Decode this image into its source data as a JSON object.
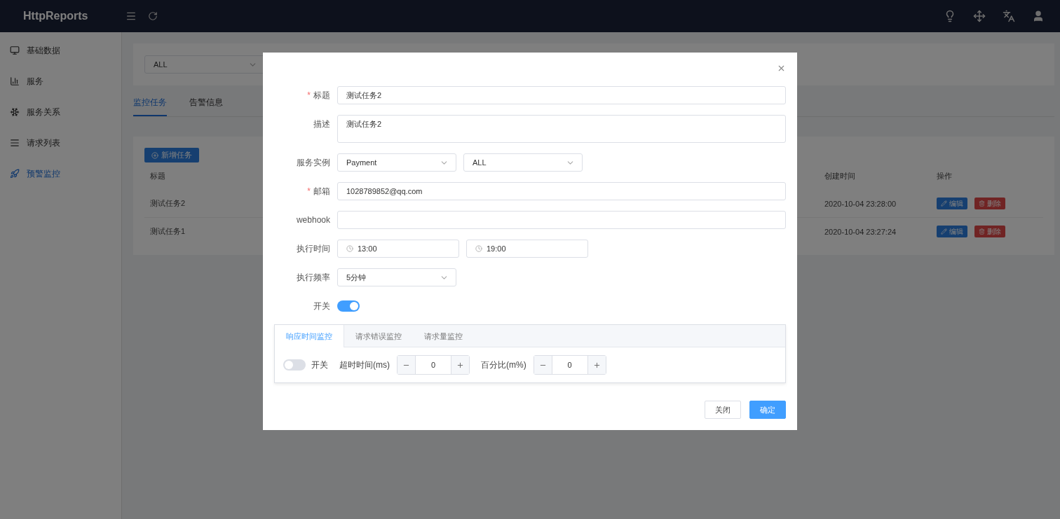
{
  "header": {
    "brand": "HttpReports"
  },
  "sidebar": {
    "items": [
      {
        "label": "基础数据",
        "kind": "monitor",
        "selected": false
      },
      {
        "label": "服务",
        "kind": "chart",
        "selected": false
      },
      {
        "label": "服务关系",
        "kind": "snowflake",
        "selected": false
      },
      {
        "label": "请求列表",
        "kind": "list",
        "selected": false
      },
      {
        "label": "预警监控",
        "kind": "rocket",
        "selected": true
      }
    ]
  },
  "filter": {
    "value": "ALL"
  },
  "tabs": [
    {
      "label": "监控任务",
      "selected": true
    },
    {
      "label": "告警信息",
      "selected": false
    }
  ],
  "task_list": {
    "add_button": "新增任务",
    "columns": [
      "标题",
      "创建时间",
      "操作"
    ],
    "rows": [
      {
        "title": "测试任务2",
        "created": "2020-10-04 23:28:00",
        "edit": "编辑",
        "delete": "删除"
      },
      {
        "title": "测试任务1",
        "created": "2020-10-04 23:27:24",
        "edit": "编辑",
        "delete": "删除"
      }
    ]
  },
  "dialog": {
    "fields": [
      {
        "kind": "text",
        "required_mark": "*",
        "label": "标题",
        "value": "测试任务2"
      },
      {
        "kind": "textarea",
        "label": "描述",
        "value": "测试任务2"
      },
      {
        "kind": "selects",
        "label": "服务实例",
        "values": [
          "Payment",
          "ALL"
        ]
      },
      {
        "kind": "text",
        "required_mark": "*",
        "label": "邮箱",
        "value": "1028789852@qq.com"
      },
      {
        "kind": "text",
        "label": "webhook"
      },
      {
        "kind": "times",
        "label": "执行时间",
        "values": [
          "13:00",
          "19:00"
        ]
      },
      {
        "kind": "selects",
        "label": "执行频率",
        "values": [
          "5分钟"
        ]
      },
      {
        "kind": "switch",
        "label": "开关",
        "on": true
      }
    ],
    "monitor_tabs": [
      {
        "label": "响应时间监控",
        "selected": true
      },
      {
        "label": "请求错误监控",
        "selected": false
      },
      {
        "label": "请求量监控",
        "selected": false
      }
    ],
    "monitor": {
      "switch_label": "开关",
      "on": false,
      "timeout_label": "超时时间(ms)",
      "timeout": "0",
      "percent_label": "百分比(m%)",
      "percent": "0"
    },
    "buttons": [
      {
        "label": "关闭",
        "kind": "default"
      },
      {
        "label": "确定",
        "kind": "primary"
      }
    ]
  }
}
